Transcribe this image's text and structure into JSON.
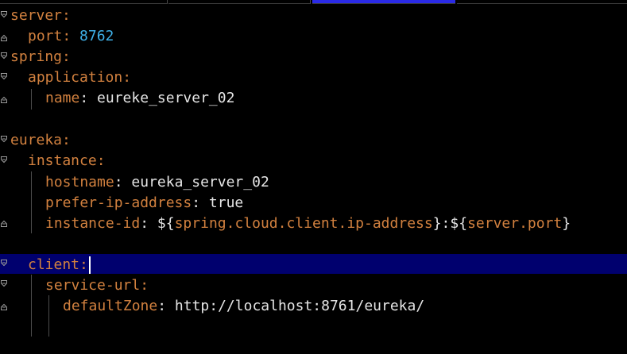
{
  "editor": {
    "lines": [
      {
        "key": "server",
        "colon": ":"
      },
      {
        "key": "port",
        "colon": ": ",
        "value": "8762"
      },
      {
        "key": "spring",
        "colon": ":"
      },
      {
        "key": "application",
        "colon": ":"
      },
      {
        "key": "name",
        "colon": ": ",
        "value": "eureke_server_02"
      },
      {
        "key": "eureka",
        "colon": ":"
      },
      {
        "key": "instance",
        "colon": ":"
      },
      {
        "key": "hostname",
        "colon": ": ",
        "value": "eureka_server_02"
      },
      {
        "key": "prefer-ip-address",
        "colon": ": ",
        "value": "true"
      },
      {
        "key": "instance-id",
        "colon": ": ",
        "p1": "${",
        "v1": "spring.cloud.client.ip-address",
        "p2": "}:${",
        "v2": "server.port",
        "p3": "}"
      },
      {
        "key": "client",
        "colon": ":"
      },
      {
        "key": "service-url",
        "colon": ":"
      },
      {
        "key": "defaultZone",
        "colon": ": ",
        "value": "http://localhost:8761/eureka/"
      }
    ]
  },
  "colors": {
    "background": "#000000",
    "key": "#d2813f",
    "number": "#3fb0e8",
    "text": "#e6e6e6",
    "current_line": "#00006e",
    "active_tab": "#2a2ae6"
  },
  "icons": [
    "fold-open-icon",
    "fold-close-icon"
  ]
}
